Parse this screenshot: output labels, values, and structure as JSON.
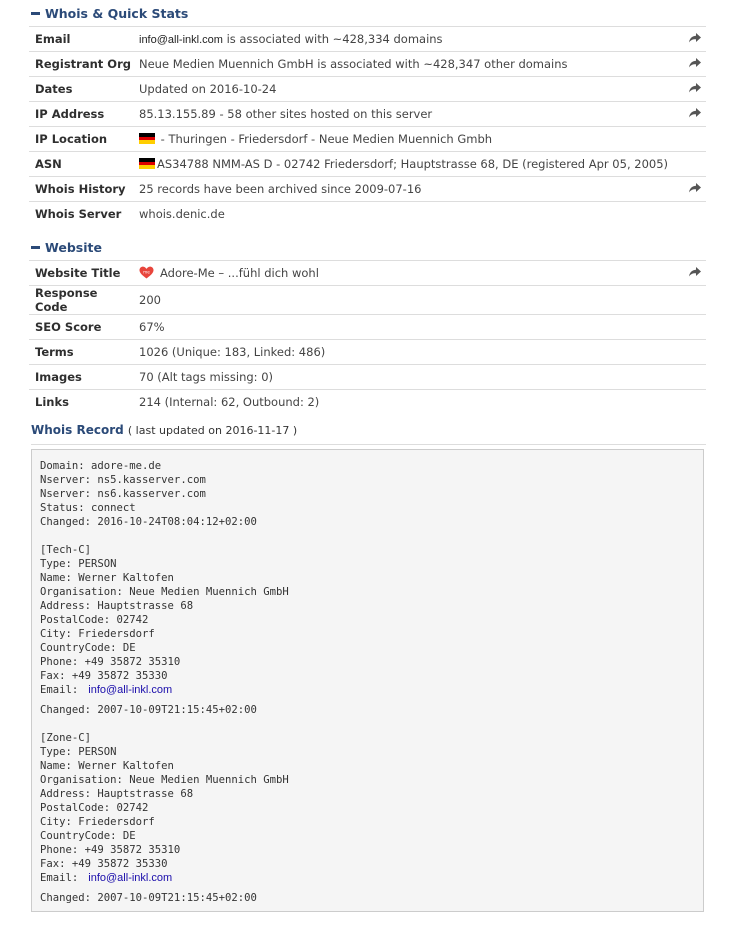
{
  "whois_section": {
    "title": "Whois & Quick Stats",
    "rows": [
      {
        "label": "Email",
        "email": "info@all-inkl.com",
        "value": " is associated with ~428,334 domains",
        "share": true
      },
      {
        "label": "Registrant Org",
        "value": "Neue Medien Muennich GmbH is associated with ~428,347 other domains",
        "share": true
      },
      {
        "label": "Dates",
        "value": "Updated on 2016-10-24",
        "share": true
      },
      {
        "label": "IP Address",
        "value": "85.13.155.89 - 58 other sites hosted on this server",
        "share": true
      },
      {
        "label": "IP Location",
        "value": " - Thuringen - Friedersdorf - Neue Medien Muennich Gmbh",
        "flag": "de",
        "share": false
      },
      {
        "label": "ASN",
        "value": "AS34788 NMM-AS D - 02742 Friedersdorf; Hauptstrasse 68, DE (registered Apr 05, 2005)",
        "flag": "de",
        "share": false
      },
      {
        "label": "Whois History",
        "value": "25 records have been archived since 2009-07-16",
        "share": true
      },
      {
        "label": "Whois Server",
        "value": "whois.denic.de",
        "share": false
      }
    ]
  },
  "website_section": {
    "title": "Website",
    "rows": [
      {
        "label": "Website Title",
        "value": "Adore-Me – ...fühl dich wohl",
        "icon": "heart-icon",
        "share": true
      },
      {
        "label": "Response Code",
        "value": "200",
        "share": false
      },
      {
        "label": "SEO Score",
        "value": "67%",
        "share": false
      },
      {
        "label": "Terms",
        "value": "1026 (Unique: 183, Linked: 486)",
        "share": false
      },
      {
        "label": "Images",
        "value": "70 (Alt tags missing: 0)",
        "share": false
      },
      {
        "label": "Links",
        "value": "214   (Internal: 62, Outbound: 2)",
        "share": false
      }
    ]
  },
  "whois_record": {
    "title": "Whois Record",
    "note": "( last updated on 2016-11-17 )",
    "lines": [
      {
        "t": "Domain: adore-me.de"
      },
      {
        "t": "Nserver: ns5.kasserver.com"
      },
      {
        "t": "Nserver: ns6.kasserver.com"
      },
      {
        "t": "Status: connect"
      },
      {
        "t": "Changed: 2016-10-24T08:04:12+02:00"
      },
      {
        "t": ""
      },
      {
        "t": "[Tech-C]"
      },
      {
        "t": "Type: PERSON"
      },
      {
        "t": "Name: Werner Kaltofen"
      },
      {
        "t": "Organisation: Neue Medien Muennich GmbH"
      },
      {
        "t": "Address: Hauptstrasse 68"
      },
      {
        "t": "PostalCode: 02742"
      },
      {
        "t": "City: Friedersdorf"
      },
      {
        "t": "CountryCode: DE"
      },
      {
        "t": "Phone: +49 35872 35310"
      },
      {
        "t": "Fax: +49 35872 35330"
      },
      {
        "t": "Email:",
        "link": "info@all-inkl.com"
      },
      {
        "t": "Changed: 2007-10-09T21:15:45+02:00"
      },
      {
        "t": ""
      },
      {
        "t": "[Zone-C]"
      },
      {
        "t": "Type: PERSON"
      },
      {
        "t": "Name: Werner Kaltofen"
      },
      {
        "t": "Organisation: Neue Medien Muennich GmbH"
      },
      {
        "t": "Address: Hauptstrasse 68"
      },
      {
        "t": "PostalCode: 02742"
      },
      {
        "t": "City: Friedersdorf"
      },
      {
        "t": "CountryCode: DE"
      },
      {
        "t": "Phone: +49 35872 35310"
      },
      {
        "t": "Fax: +49 35872 35330"
      },
      {
        "t": "Email:",
        "link": "info@all-inkl.com"
      },
      {
        "t": "Changed: 2007-10-09T21:15:45+02:00"
      }
    ]
  },
  "colors": {
    "heading": "#2b4a78",
    "link": "#1a0dab",
    "record_bg": "#f5f5f5",
    "share_icon": "#555555"
  }
}
